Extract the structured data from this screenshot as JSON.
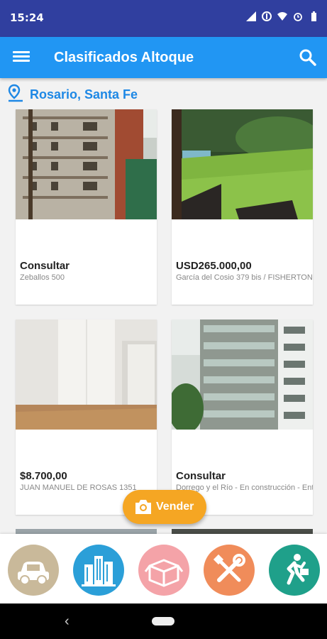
{
  "status_bar": {
    "time": "15:24"
  },
  "app_bar": {
    "title": "Clasificados Altoque",
    "menu_icon": "hamburger-menu-icon",
    "search_icon": "search-icon"
  },
  "location": {
    "label": "Rosario, Santa Fe",
    "icon": "location-pin-icon"
  },
  "listings": [
    {
      "price": "Consultar",
      "address": "Zeballos 500"
    },
    {
      "price": "USD265.000,00",
      "address": "García del Cosio 379 bis / FISHERTON"
    },
    {
      "price": "$8.700,00",
      "address": "JUAN MANUEL DE ROSAS 1351"
    },
    {
      "price": "Consultar",
      "address": "Dorrego y el Río - En construcción - Entrega"
    }
  ],
  "fab": {
    "label": "Vender",
    "icon": "camera-icon"
  },
  "categories": [
    {
      "name": "vehicles",
      "icon": "car-icon",
      "color": "#c9b99a"
    },
    {
      "name": "real-estate",
      "icon": "buildings-icon",
      "color": "#2b9fd8"
    },
    {
      "name": "products",
      "icon": "box-icon",
      "color": "#f4a3a8"
    },
    {
      "name": "services",
      "icon": "tools-icon",
      "color": "#f08c5a"
    },
    {
      "name": "jobs",
      "icon": "running-man-icon",
      "color": "#1fa08a"
    }
  ],
  "colors": {
    "status_bar": "#303f9f",
    "app_bar": "#2196f3",
    "accent": "#f5a623",
    "location": "#1e88e5"
  }
}
